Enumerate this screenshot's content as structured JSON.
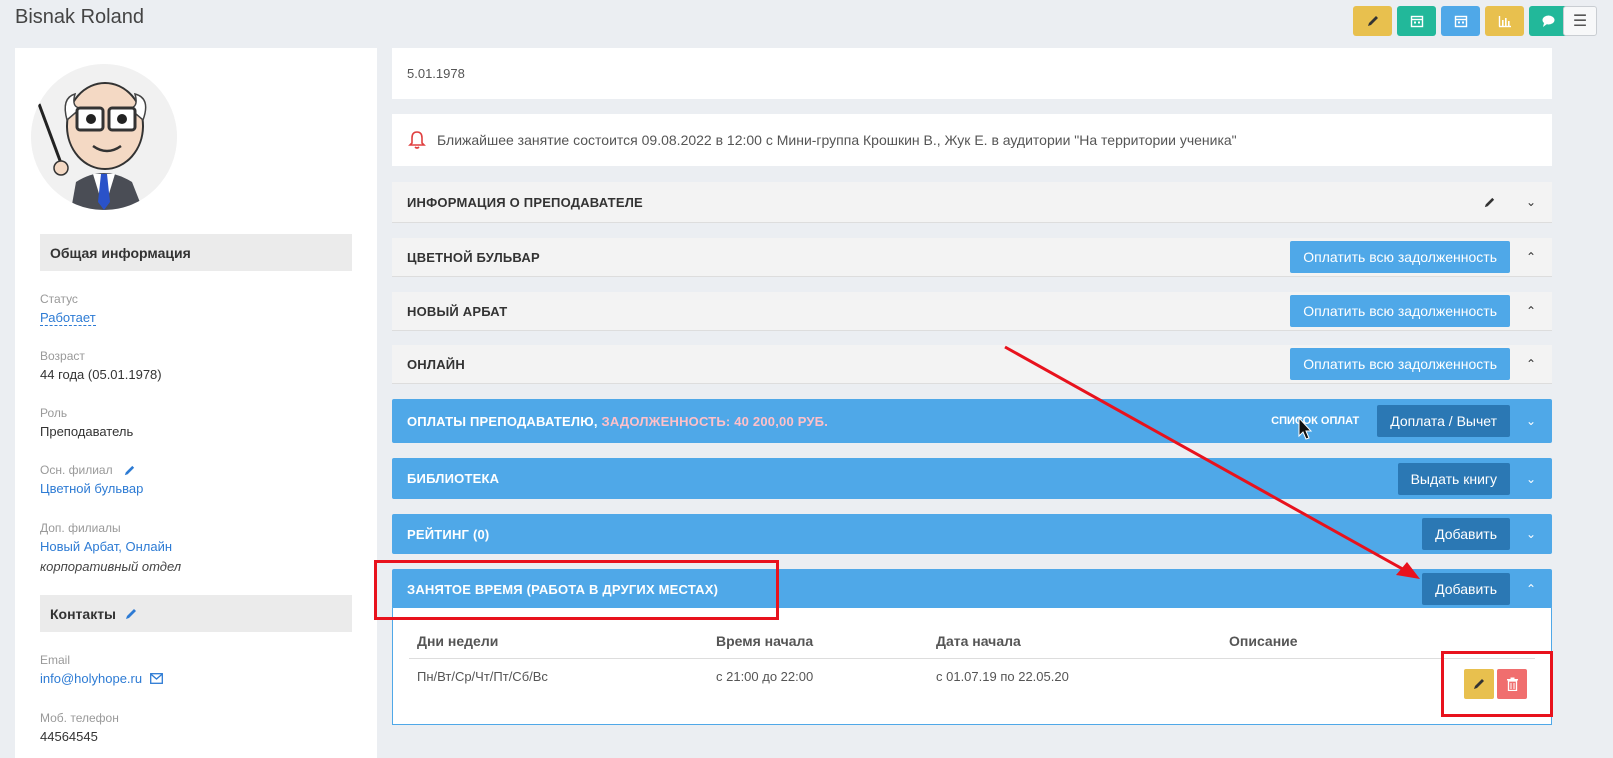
{
  "header": {
    "title": "Bisnak Roland",
    "toolbar": [
      {
        "icon": "pencil-icon",
        "color": "#e8c04e"
      },
      {
        "icon": "calendar-icon",
        "color": "#22b89a"
      },
      {
        "icon": "calendar-icon",
        "color": "#4fa8e8"
      },
      {
        "icon": "bar-chart-icon",
        "color": "#e8c04e"
      },
      {
        "icon": "chat-icon",
        "color": "#22b89a"
      }
    ],
    "menu_icon": "hamburger-icon"
  },
  "profile": {
    "general_header": "Общая информация",
    "status_label": "Статус",
    "status_value": "Работает",
    "age_label": "Возраст",
    "age_value": "44 года (05.01.1978)",
    "role_label": "Роль",
    "role_value": "Преподаватель",
    "main_branch_label": "Осн. филиал",
    "main_branch_value": "Цветной бульвар",
    "extra_branches_label": "Доп. филиалы",
    "extra_branch_1": "Новый Арбат",
    "extra_branch_sep": ", ",
    "extra_branch_2": "Онлайн",
    "extra_branch_note": "корпоративный отдел",
    "contacts_header": "Контакты",
    "email_label": "Email",
    "email_value": "info@holyhope.ru",
    "phone_label": "Моб. телефон",
    "phone_value": "44564545"
  },
  "main": {
    "birthdate": "5.01.1978",
    "notice": "Ближайшее занятие состоится 09.08.2022 в 12:00 с Мини-группа Крошкин В., Жук Е. в аудитории \"На территории ученика\"",
    "panels": {
      "teacher_info": "ИНФОРМАЦИЯ О ПРЕПОДАВАТЕЛЕ",
      "branch_1": "ЦВЕТНОЙ БУЛЬВАР",
      "branch_2": "НОВЫЙ АРБАТ",
      "branch_3": "ОНЛАЙН",
      "pay_debt_label": "Оплатить всю задолженность",
      "payments": "ОПЛАТЫ ПРЕПОДАВАТЕЛЮ, ",
      "payments_debt": "ЗАДОЛЖЕННОСТЬ: 40 200,00 РУБ.",
      "payments_list": "СПИСОК ОПЛАТ",
      "payments_btn": "Доплата / Вычет",
      "library": "БИБЛИОТЕКА",
      "library_btn": "Выдать книгу",
      "rating": "РЕЙТИНГ (0)",
      "rating_btn": "Добавить",
      "busy_time": "ЗАНЯТОЕ ВРЕМЯ (РАБОТА В ДРУГИХ МЕСТАХ)",
      "busy_time_btn": "Добавить"
    },
    "busy_table": {
      "headers": [
        "Дни недели",
        "Время начала",
        "Дата начала",
        "Описание"
      ],
      "rows": [
        [
          "Пн/Вт/Ср/Чт/Пт/Сб/Вс",
          "с 21:00 до 22:00",
          "с 01.07.19 по 22.05.20",
          ""
        ]
      ]
    }
  },
  "colors": {
    "accent_blue": "#4fa8e8",
    "dark_blue": "#2b78b4",
    "annotation_red": "#e8121d",
    "warn_yellow": "#e8c04e",
    "danger_red": "#f06e6e"
  }
}
